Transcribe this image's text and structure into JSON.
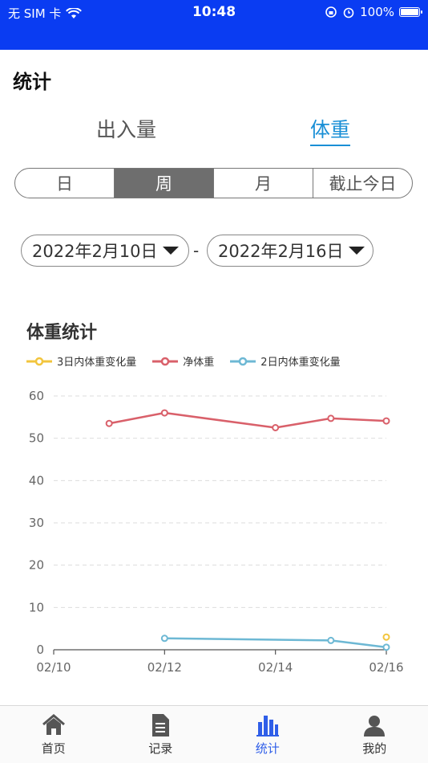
{
  "status": {
    "carrier": "无 SIM 卡",
    "time": "10:48",
    "battery": "100%",
    "battery_level": 1.0
  },
  "page_title": "统计",
  "main_tabs": [
    {
      "label": "出入量",
      "active": false
    },
    {
      "label": "体重",
      "active": true
    }
  ],
  "period_tabs": [
    {
      "label": "日",
      "active": false
    },
    {
      "label": "周",
      "active": true
    },
    {
      "label": "月",
      "active": false
    },
    {
      "label": "截止今日",
      "active": false
    }
  ],
  "date_range": {
    "start": "2022年2月10日",
    "separator": "-",
    "end": "2022年2月16日"
  },
  "chart_title": "体重统计",
  "colors": {
    "accent": "#1a8fd6",
    "header": "#0a3cf2",
    "tab_active": "#2f5ee8"
  },
  "chart_data": {
    "type": "line",
    "x": [
      "02/10",
      "02/11",
      "02/12",
      "02/13",
      "02/14",
      "02/15",
      "02/16"
    ],
    "xticks": [
      "02/10",
      "02/12",
      "02/14",
      "02/16"
    ],
    "ylim": [
      0,
      60
    ],
    "yticks": [
      0,
      10,
      20,
      30,
      40,
      50,
      60
    ],
    "grid": true,
    "legend_position": "top-left",
    "series": [
      {
        "name": "3日内体重变化量",
        "color": "#f2c53d",
        "values": [
          null,
          null,
          null,
          null,
          null,
          null,
          3
        ]
      },
      {
        "name": "净体重",
        "color": "#d9606a",
        "values": [
          null,
          53.5,
          56,
          null,
          52.5,
          54.7,
          54.1
        ]
      },
      {
        "name": "2日内体重变化量",
        "color": "#6db8d4",
        "values": [
          null,
          null,
          2.7,
          null,
          null,
          2.2,
          0.6
        ]
      }
    ]
  },
  "tabbar": [
    {
      "label": "首页",
      "icon": "home-icon",
      "active": false
    },
    {
      "label": "记录",
      "icon": "document-icon",
      "active": false
    },
    {
      "label": "统计",
      "icon": "bar-chart-icon",
      "active": true
    },
    {
      "label": "我的",
      "icon": "user-icon",
      "active": false
    }
  ]
}
